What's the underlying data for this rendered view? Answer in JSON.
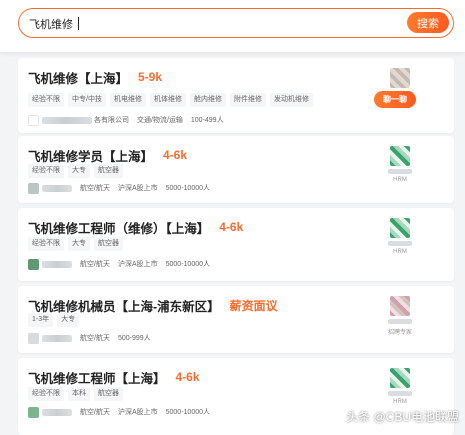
{
  "search": {
    "value": "飞机维修",
    "button_label": "搜索"
  },
  "jobs": [
    {
      "title": "飞机维修【上海】",
      "salary": "5-9k",
      "tags": [
        "经验不限",
        "中专/中技",
        "机电维修",
        "机体维修",
        "舱内维修",
        "附件维修",
        "发动机维修"
      ],
      "company_suffix": "各有限公司",
      "meta": [
        "交通/物流/运输",
        "100-499人"
      ],
      "recruiter_role": "",
      "chat_label": "聊一聊"
    },
    {
      "title": "飞机维修学员【上海】",
      "salary": "4-6k",
      "tags": [
        "经验不限",
        "大专",
        "航空器"
      ],
      "meta": [
        "航空/航天",
        "沪深A股上市",
        "5000-10000人"
      ],
      "recruiter_role": "HRM"
    },
    {
      "title": "飞机维修工程师（维修）【上海】",
      "salary": "4-6k",
      "tags": [
        "经验不限",
        "大专",
        "航空器"
      ],
      "meta": [
        "航空/航天",
        "沪深A股上市",
        "5000-10000人"
      ],
      "recruiter_role": "HRM"
    },
    {
      "title": "飞机维修机械员【上海-浦东新区】",
      "salary": "薪资面议",
      "tags": [
        "1-3年",
        "大专"
      ],
      "meta": [
        "航空/航天",
        "500-999人"
      ],
      "recruiter_role": "招聘专家"
    },
    {
      "title": "飞机维修工程师【上海】",
      "salary": "4-6k",
      "tags": [
        "经验不限",
        "本科",
        "航空器"
      ],
      "meta": [
        "航空/航天",
        "沪深A股上市",
        "5000-10000人"
      ],
      "recruiter_role": "HRM"
    }
  ],
  "watermark": "头条 @CBU电池联盟"
}
